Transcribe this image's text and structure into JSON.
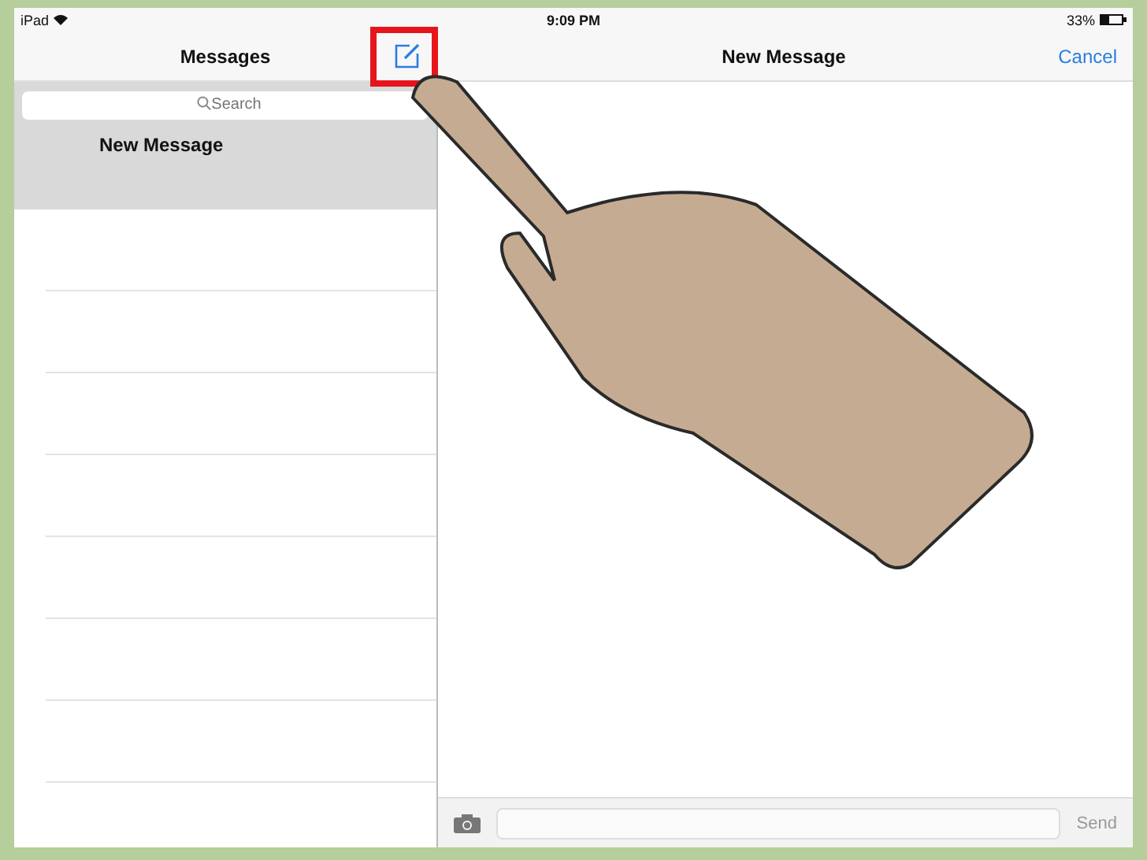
{
  "status_bar": {
    "device": "iPad",
    "time": "9:09 PM",
    "battery": "33%"
  },
  "sidebar": {
    "title": "Messages",
    "compose_highlighted": true,
    "search": {
      "placeholder": "Search"
    },
    "conversations": [
      {
        "title": "New Message",
        "selected": true
      }
    ]
  },
  "compose": {
    "title": "New Message",
    "cancel": "Cancel",
    "send": "Send"
  }
}
